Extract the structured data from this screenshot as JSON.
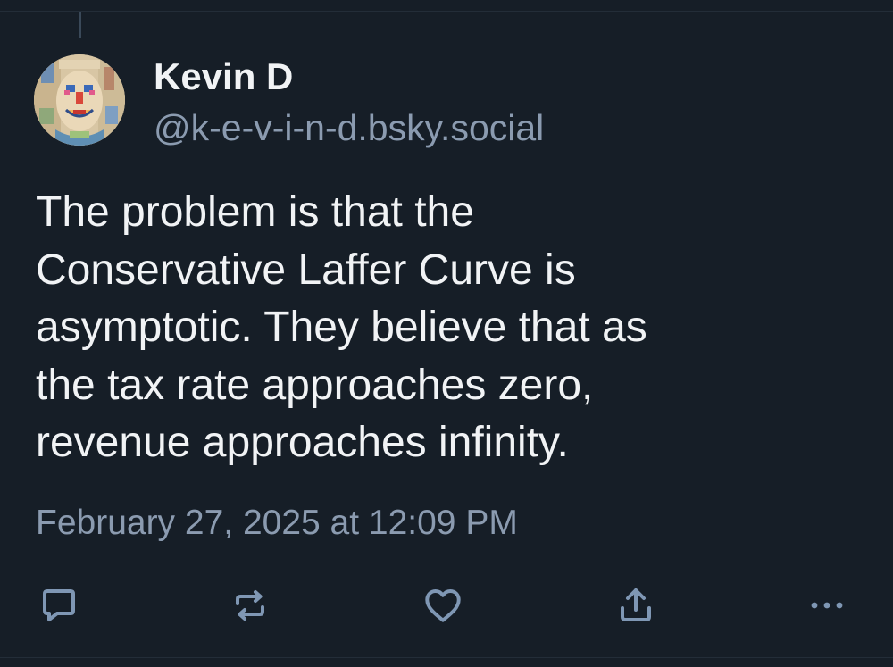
{
  "author": {
    "display_name": "Kevin D",
    "handle": "@k-e-v-i-n-d.bsky.social",
    "avatar_icon": "abstract-face-portrait"
  },
  "post": {
    "lines": [
      "The problem is that the",
      "Conservative Laffer Curve is",
      "asymptotic. They believe that as",
      "the tax rate approaches zero,",
      "revenue approaches infinity."
    ],
    "timestamp": "February 27, 2025 at 12:09 PM"
  },
  "actions": [
    {
      "name": "reply",
      "icon": "speech-bubble-icon"
    },
    {
      "name": "repost",
      "icon": "repost-arrows-icon"
    },
    {
      "name": "like",
      "icon": "heart-icon"
    },
    {
      "name": "share",
      "icon": "share-upload-icon"
    },
    {
      "name": "more",
      "icon": "ellipsis-icon"
    }
  ],
  "colors": {
    "background": "#161e27",
    "text_primary": "#f1f3f5",
    "text_secondary": "#8b9bb0",
    "icon": "#7f97b4"
  }
}
